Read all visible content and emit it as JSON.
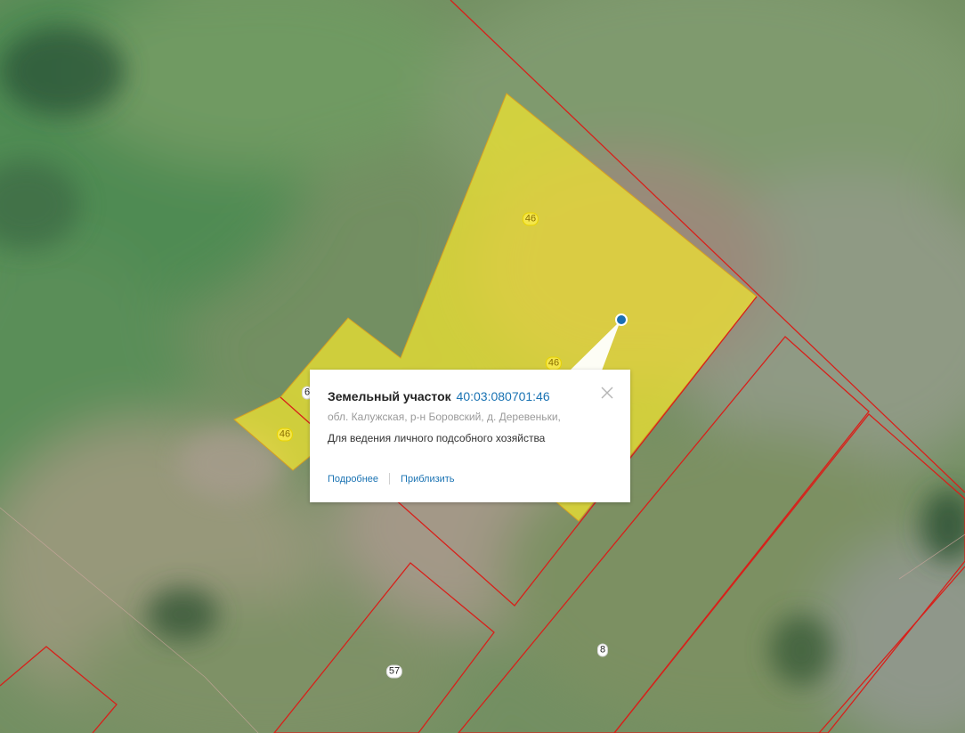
{
  "map": {
    "parcel_labels": [
      {
        "text": "46",
        "kind": "selected"
      },
      {
        "text": "46",
        "kind": "selected"
      },
      {
        "text": "46",
        "kind": "selected"
      },
      {
        "text": "6",
        "kind": "plain"
      },
      {
        "text": "57",
        "kind": "plain"
      },
      {
        "text": "8",
        "kind": "plain"
      }
    ],
    "colors": {
      "parcel_border": "#d8201a",
      "selected_fill": "#f2e62e",
      "marker": "#1a6fb3",
      "link": "#1a73b3"
    }
  },
  "popup": {
    "kind": "Земельный участок",
    "cadastral_number": "40:03:080701:46",
    "address": "обл. Калужская, р-н Боровский, д. Деревеньки,",
    "usage": "Для ведения личного подсобного хозяйства",
    "actions": {
      "details": "Подробнее",
      "zoom": "Приблизить"
    },
    "close_icon": "close-icon"
  }
}
